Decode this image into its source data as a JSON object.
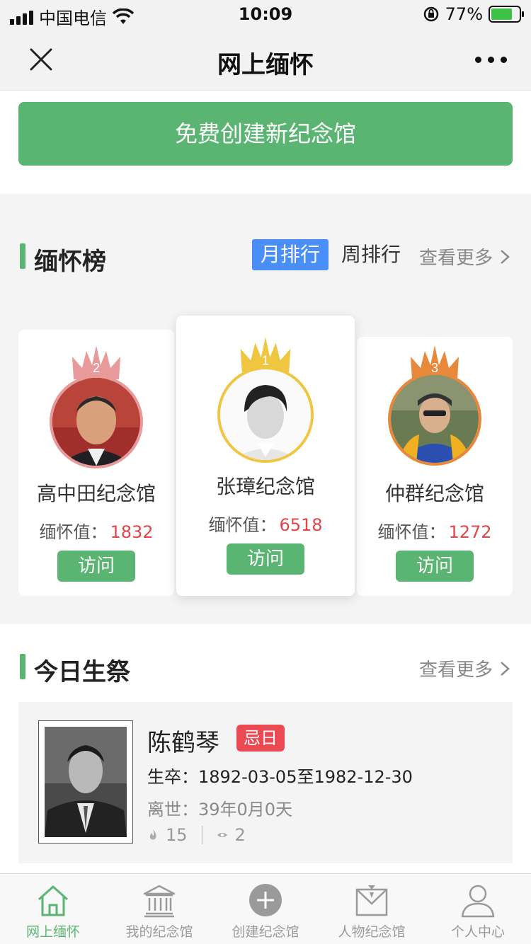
{
  "status_bar": {
    "carrier": "中国电信",
    "time": "10:09",
    "battery_percent": "77%",
    "battery_level": 0.77
  },
  "nav": {
    "title": "网上缅怀"
  },
  "create_button": "免费创建新纪念馆",
  "ranking": {
    "title": "缅怀榜",
    "tabs": [
      "月排行",
      "周排行"
    ],
    "active_tab": "月排行",
    "see_more": "查看更多",
    "visit_label": "访问",
    "value_label": "缅怀值：",
    "cards": [
      {
        "rank": "2",
        "name": "高中田纪念馆",
        "value": "1832"
      },
      {
        "rank": "1",
        "name": "张璋纪念馆",
        "value": "6518"
      },
      {
        "rank": "3",
        "name": "仲群纪念馆",
        "value": "1272"
      }
    ],
    "colors": {
      "rank1": "#f0c640",
      "rank2": "#e89a9a",
      "rank3": "#e8883a"
    }
  },
  "today": {
    "title": "今日生祭",
    "see_more": "查看更多",
    "person": {
      "name": "陈鹤琴",
      "badge": "忌日",
      "life": "生卒：1892-03-05至1982-12-30",
      "passed": "离世：39年0月0天",
      "flowers": "15",
      "views": "2"
    }
  },
  "tabbar": {
    "items": [
      {
        "label": "网上缅怀",
        "icon": "home-icon",
        "active": true
      },
      {
        "label": "我的纪念馆",
        "icon": "memorial-hall-icon",
        "active": false
      },
      {
        "label": "创建纪念馆",
        "icon": "plus-circle-icon",
        "active": false
      },
      {
        "label": "人物纪念馆",
        "icon": "person-hall-icon",
        "active": false
      },
      {
        "label": "个人中心",
        "icon": "user-icon",
        "active": false
      }
    ]
  },
  "accent_color": "#5bb572"
}
